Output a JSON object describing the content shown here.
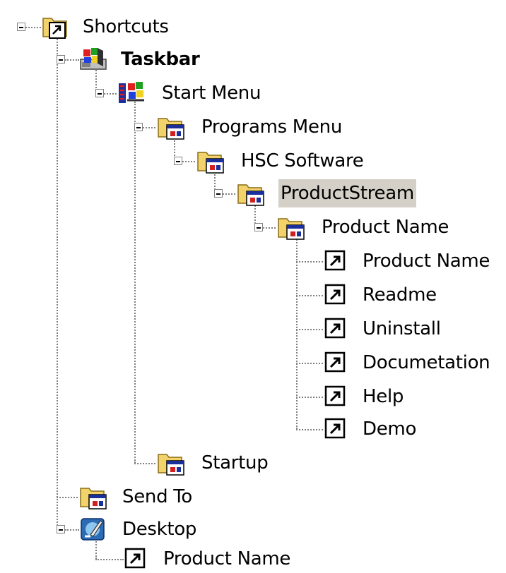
{
  "tree": {
    "shortcuts": "Shortcuts",
    "taskbar": "Taskbar",
    "start_menu": "Start Menu",
    "programs_menu": "Programs Menu",
    "hsc_software": "HSC Software",
    "productstream": "ProductStream",
    "product_name_folder": "Product Name",
    "items": [
      "Product Name",
      "Readme",
      "Uninstall",
      "Documetation",
      "Help",
      "Demo"
    ],
    "startup": "Startup",
    "send_to": "Send To",
    "desktop": "Desktop",
    "desktop_product_name": "Product Name"
  },
  "colors": {
    "selection": "#d4d0c8",
    "lines": "#808080",
    "folder": "#f2d36b"
  },
  "icons": {
    "shortcuts": "folder-shortcut-icon",
    "taskbar": "taskbar-icon",
    "start_menu": "start-menu-icon",
    "program_folder": "program-folder-icon",
    "shortcut": "shortcut-icon",
    "desktop": "desktop-icon"
  }
}
